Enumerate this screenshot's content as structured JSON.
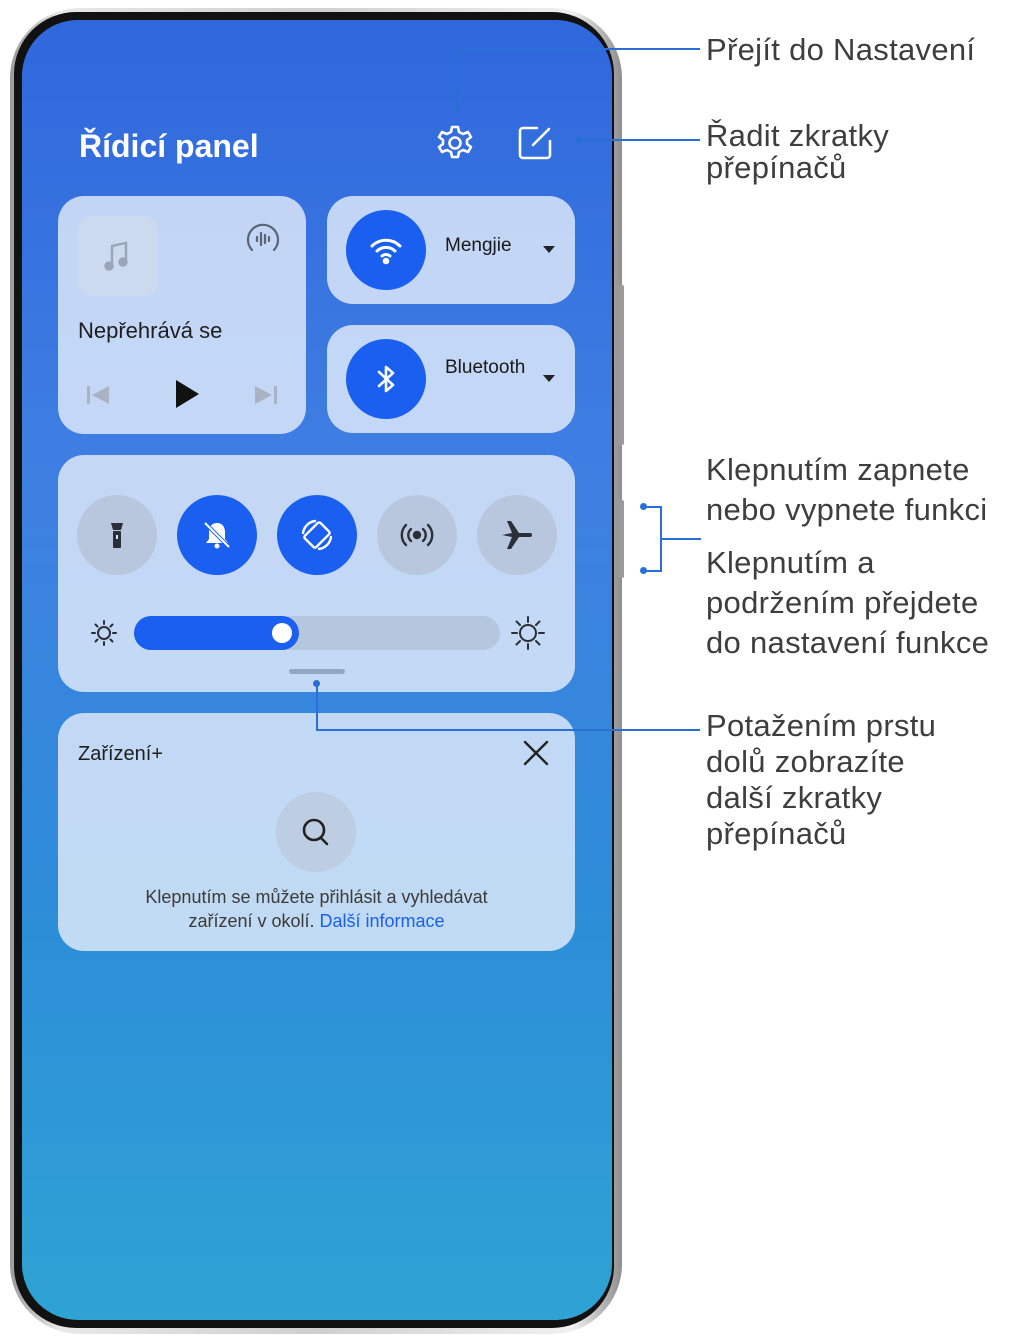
{
  "panel": {
    "title": "Řídicí panel",
    "icons": {
      "settings": "gear-icon",
      "edit": "edit-icon"
    }
  },
  "media": {
    "status": "Nepřehrává se",
    "icons": [
      "music-note-icon",
      "audio-output-icon",
      "previous-icon",
      "play-icon",
      "next-icon"
    ]
  },
  "wifi": {
    "label": "Mengjie",
    "icon": "wifi-icon",
    "on": true
  },
  "bluetooth": {
    "label": "Bluetooth",
    "icon": "bluetooth-icon",
    "on": true
  },
  "toggles": [
    {
      "icon": "flashlight-icon",
      "on": false
    },
    {
      "icon": "silent-bell-icon",
      "on": true
    },
    {
      "icon": "auto-rotate-icon",
      "on": true
    },
    {
      "icon": "hotspot-icon",
      "on": false
    },
    {
      "icon": "airplane-icon",
      "on": false
    }
  ],
  "brightness": {
    "level_percent": 45
  },
  "device": {
    "title": "Zařízení+",
    "text_line1": "Klepnutím se můžete přihlásit a vyhledávat",
    "text_line2": "zařízení v okolí.",
    "link": "Další informace"
  },
  "annotations": {
    "settings": "Přejít do Nastavení",
    "sort_line1": "Řadit zkratky",
    "sort_line2": "přepínačů",
    "toggle_line1": "Klepnutím zapnete",
    "toggle_line2": "nebo vypnete funkci",
    "hold_line1": "Klepnutím a",
    "hold_line2": "podržením přejdete",
    "hold_line3": "do nastavení funkce",
    "swipe_line1": "Potažením prstu",
    "swipe_line2": "dolů zobrazíte",
    "swipe_line3": "další zkratky",
    "swipe_line4": "přepínačů"
  },
  "colors": {
    "accent": "#1a5ff0",
    "annotation_line": "#2a6fd6",
    "annotation_text": "#3e3e3e"
  }
}
